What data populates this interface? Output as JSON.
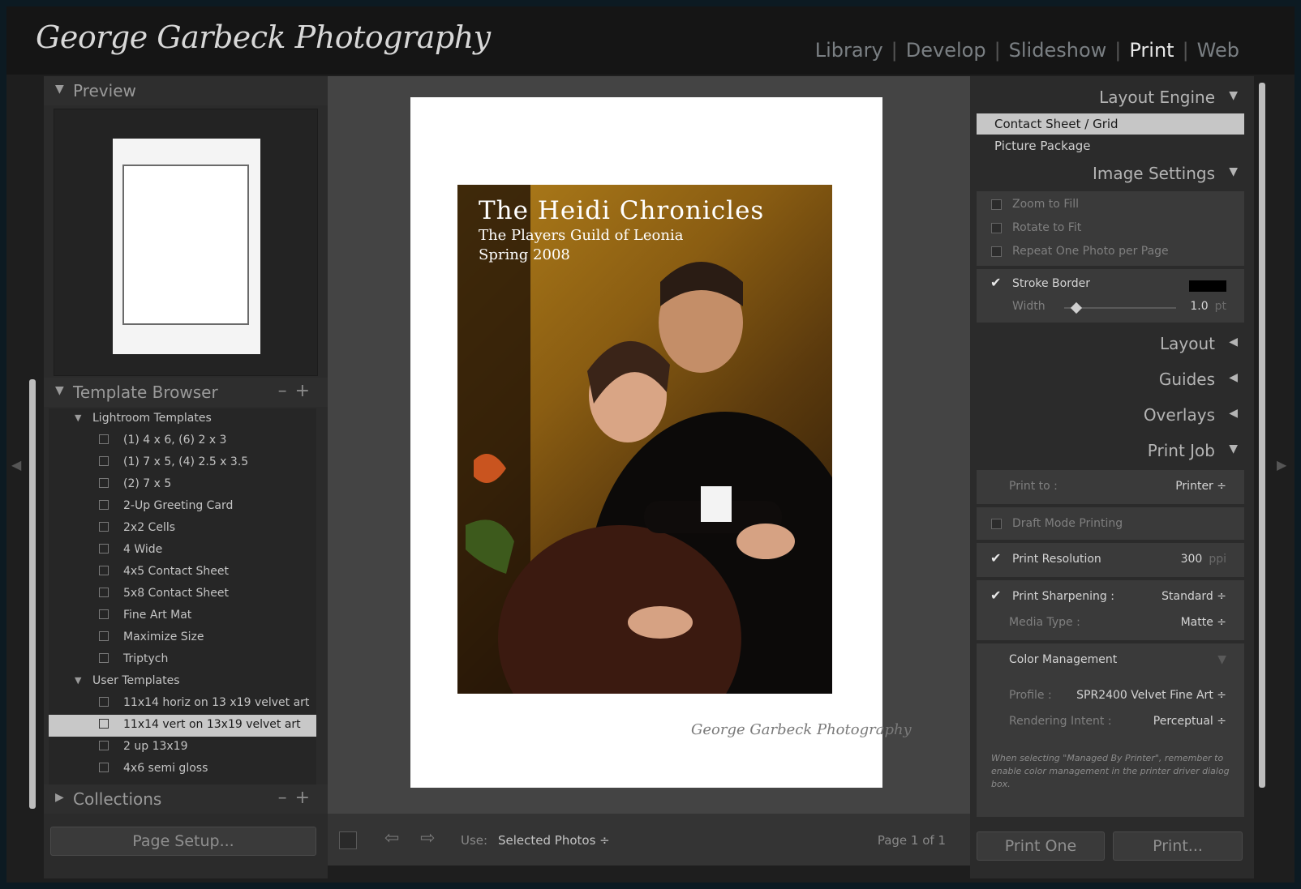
{
  "app": {
    "identity_plate": "George Garbeck Photography",
    "modules": [
      "Library",
      "Develop",
      "Slideshow",
      "Print",
      "Web"
    ],
    "active_module": "Print"
  },
  "left_panel": {
    "preview": {
      "label": "Preview"
    },
    "template_browser": {
      "label": "Template Browser",
      "folders": [
        {
          "name": "Lightroom Templates",
          "items": [
            "(1) 4 x 6, (6) 2 x 3",
            "(1) 7 x 5, (4) 2.5 x 3.5",
            "(2) 7 x 5",
            "2-Up Greeting Card",
            "2x2 Cells",
            "4 Wide",
            "4x5 Contact Sheet",
            "5x8 Contact Sheet",
            "Fine Art Mat",
            "Maximize Size",
            "Triptych"
          ]
        },
        {
          "name": "User Templates",
          "items": [
            "11x14 horiz on 13 x19 velvet art",
            "11x14 vert on 13x19 velvet art",
            "2 up 13x19",
            "4x6 semi gloss"
          ]
        }
      ],
      "selected_item": "11x14 vert on 13x19 velvet art"
    },
    "collections": {
      "label": "Collections"
    },
    "page_setup_button": "Page Setup..."
  },
  "center": {
    "poster": {
      "title": "The Heidi Chronicles",
      "subtitle": "The Players Guild of Leonia",
      "date": "Spring 2008"
    },
    "page_signature": "George Garbeck Photography",
    "toolbar": {
      "use_label": "Use:",
      "use_value": "Selected Photos ÷",
      "page_indicator": "Page 1 of 1"
    }
  },
  "right_panel": {
    "layout_engine": {
      "label": "Layout Engine",
      "options": [
        "Contact Sheet / Grid",
        "Picture Package"
      ],
      "selected": "Contact Sheet / Grid"
    },
    "image_settings": {
      "label": "Image Settings",
      "zoom_to_fill": "Zoom to Fill",
      "rotate_to_fit": "Rotate to Fit",
      "repeat_one_photo": "Repeat One Photo per Page",
      "stroke_border": "Stroke Border",
      "stroke_color": "#000000",
      "width_label": "Width",
      "width_value": "1.0",
      "width_unit": "pt",
      "width_fraction": 0.08
    },
    "layout": {
      "label": "Layout"
    },
    "guides": {
      "label": "Guides"
    },
    "overlays": {
      "label": "Overlays"
    },
    "print_job": {
      "label": "Print Job",
      "print_to_label": "Print to :",
      "print_to_value": "Printer ÷",
      "draft_mode": "Draft Mode Printing",
      "print_resolution": "Print Resolution",
      "resolution_value": "300",
      "resolution_unit": "ppi",
      "print_sharpening": "Print Sharpening :",
      "sharpening_value": "Standard ÷",
      "media_type_label": "Media Type :",
      "media_type_value": "Matte ÷",
      "color_management": "Color Management",
      "profile_label": "Profile :",
      "profile_value": "SPR2400 Velvet Fine Art ÷",
      "rendering_label": "Rendering Intent :",
      "rendering_value": "Perceptual ÷",
      "note": "When selecting \"Managed By Printer\", remember to enable color management in the printer driver dialog box."
    },
    "print_one_button": "Print One",
    "print_button": "Print..."
  }
}
